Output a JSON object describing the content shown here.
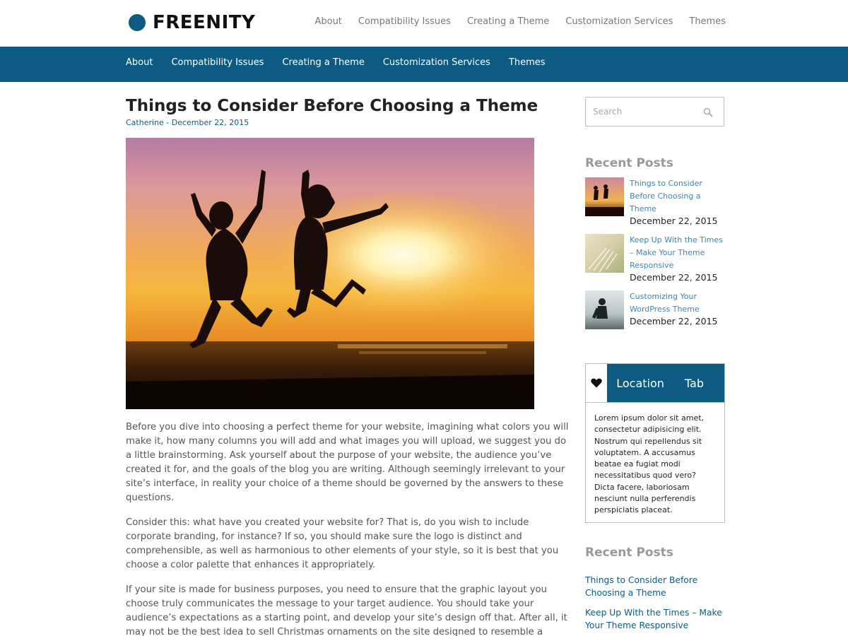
{
  "brand": {
    "name": "FREENITY",
    "color": "#0d5b82"
  },
  "top_nav": [
    "About",
    "Compatibility Issues",
    "Creating a Theme",
    "Customization Services",
    "Themes"
  ],
  "main_nav": [
    "About",
    "Compatibility Issues",
    "Creating a Theme",
    "Customization Services",
    "Themes"
  ],
  "post": {
    "title": "Things to Consider Before Choosing a Theme",
    "meta": "Catherine - December 22, 2015",
    "paragraphs": [
      "Before you dive into choosing a perfect theme for your website, imagining what colors you will make it, how many columns you will add and what images you will upload, we suggest you do a little brainstorming. Ask yourself about the purpose of your website, the audience you’ve created it for, and the goals of the blog you are writing. Although seemingly irrelevant to your site’s interface, in reality your choice of a theme should be governed by the answers to these questions.",
      "Consider this: what have you created your website for? That is, do you wish to include corporate branding, for instance? If so, you should make sure the logo is distinct and comprehensible, as well as harmonious to other elements of your style, so it is best that you choose a color palette that enhances it appropriately.",
      "If your site is made for business purposes, you need to ensure that the graphic layout you choose truly communicates the message to your target audience. You should take your audience’s expectations as a starting point, and develop your site’s design off that. After all, it may not be the best idea to sell Christmas ornaments on the site designed to resemble a haunted house."
    ]
  },
  "search": {
    "placeholder": "Search",
    "value": ""
  },
  "sidebar": {
    "recent_posts_title": "Recent Posts",
    "recent_posts": [
      {
        "title": "Things to Consider Before Choosing a Theme",
        "date": "December 22, 2015"
      },
      {
        "title": "Keep Up With the Times – Make Your Theme Responsive",
        "date": "December 22, 2015"
      },
      {
        "title": "Customizing Your WordPress Theme",
        "date": "December 22, 2015"
      }
    ],
    "tabs": {
      "active_label": "Location",
      "other_label": "Tab",
      "content": "Lorem ipsum dolor sit amet, consectetur adipisicing elit. Nostrum qui repellendus sit voluptatem. A accusamus beatae ea fugiat modi necessitatibus quod vero? Dicta facere, laboriosam nesciunt nulla perferendis perspiciatis placeat."
    },
    "recent_posts_title_2": "Recent Posts",
    "recent_links": [
      "Things to Consider Before Choosing a Theme",
      "Keep Up With the Times – Make Your Theme Responsive"
    ]
  },
  "icons": {
    "search": "search-icon",
    "tab": "heart-icon"
  }
}
